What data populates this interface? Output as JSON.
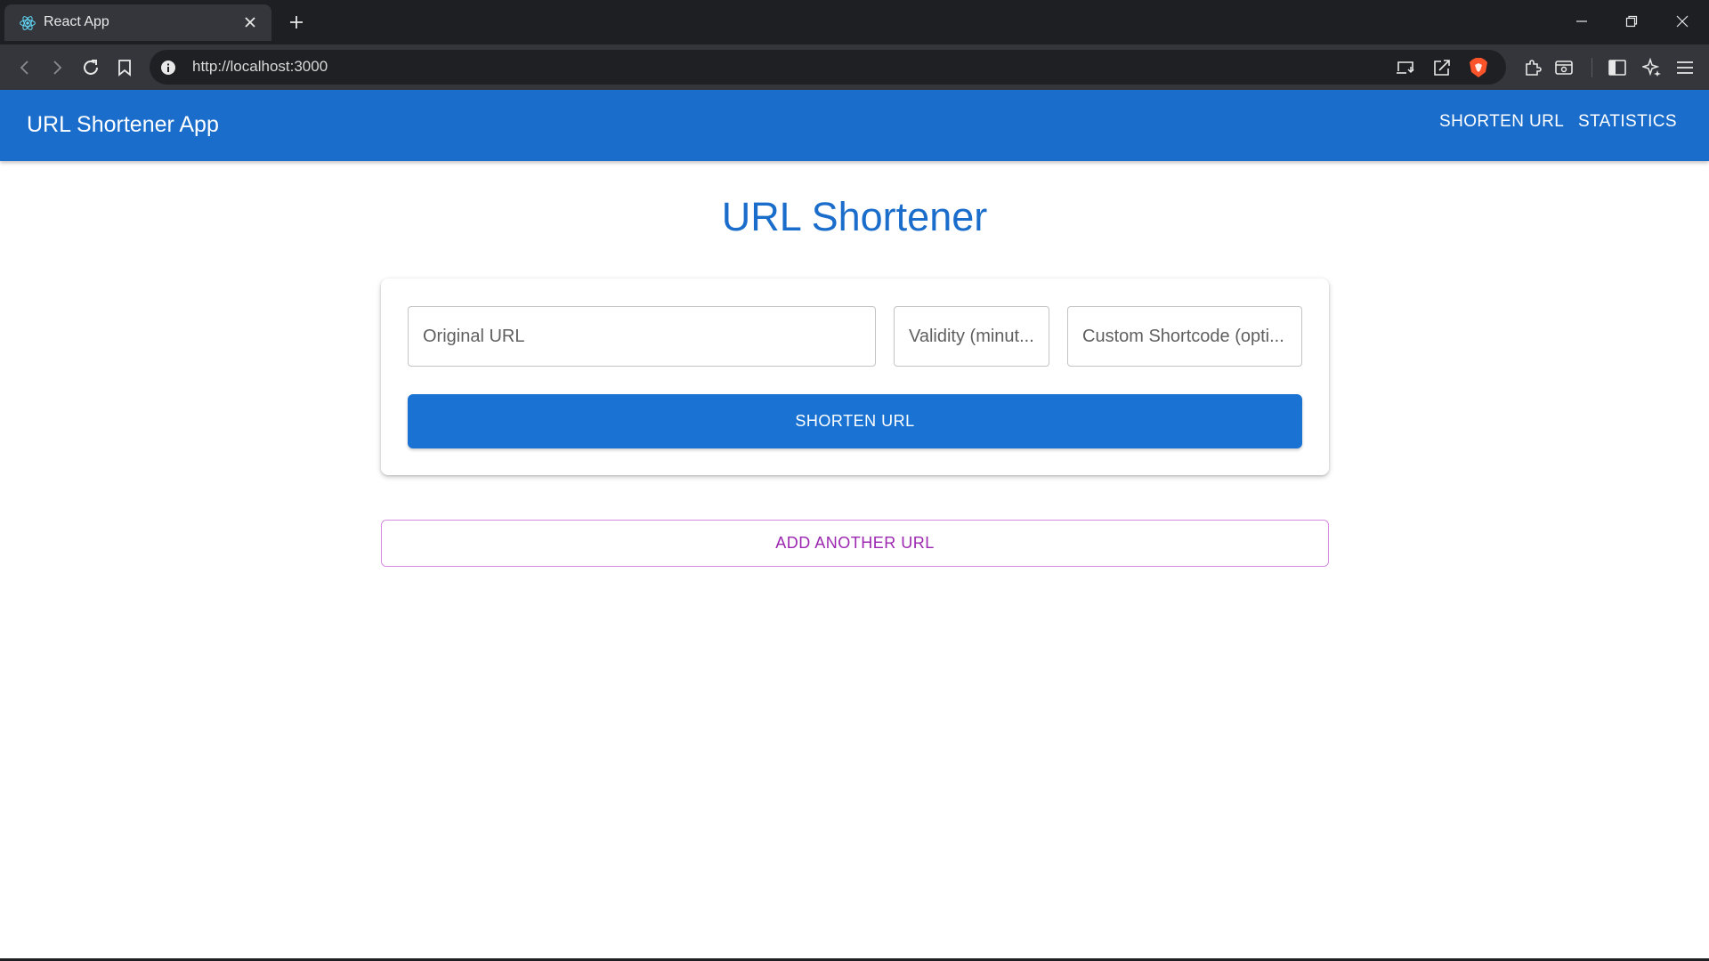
{
  "browser": {
    "tab": {
      "title": "React App",
      "icon": "react-logo-icon"
    },
    "address": {
      "url": "http://localhost:3000"
    },
    "colors": {
      "chrome_dark": "#1e1f23",
      "toolbar": "#35363b",
      "brave_orange": "#fb542b"
    }
  },
  "appbar": {
    "title": "URL Shortener App",
    "nav": {
      "shorten": "SHORTEN URL",
      "statistics": "STATISTICS"
    },
    "color": "#1a6dcb"
  },
  "main": {
    "title": "URL Shortener",
    "form": {
      "original_url": {
        "placeholder": "Original URL",
        "value": ""
      },
      "validity": {
        "placeholder": "Validity (minut...",
        "value": ""
      },
      "shortcode": {
        "placeholder": "Custom Shortcode (opti...",
        "value": ""
      },
      "submit_label": "SHORTEN URL"
    },
    "add_another_label": "ADD ANOTHER URL",
    "accent_secondary": "#9c27b0"
  }
}
